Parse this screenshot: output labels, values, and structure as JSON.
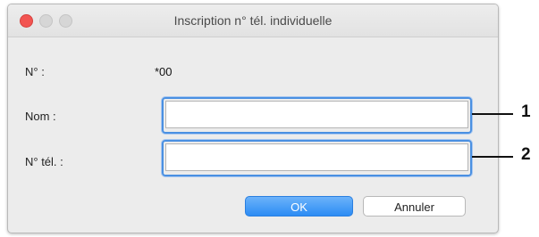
{
  "window": {
    "title": "Inscription n° tél. individuelle"
  },
  "form": {
    "number_label": "N° :",
    "number_value": "*00",
    "name_label": "Nom :",
    "name_value": "",
    "phone_label": "N° tél. :",
    "phone_value": ""
  },
  "buttons": {
    "ok_label": "OK",
    "cancel_label": "Annuler"
  },
  "callouts": {
    "one": "1",
    "two": "2"
  },
  "colors": {
    "accent": "#2c8cf4",
    "close": "#f25451"
  }
}
